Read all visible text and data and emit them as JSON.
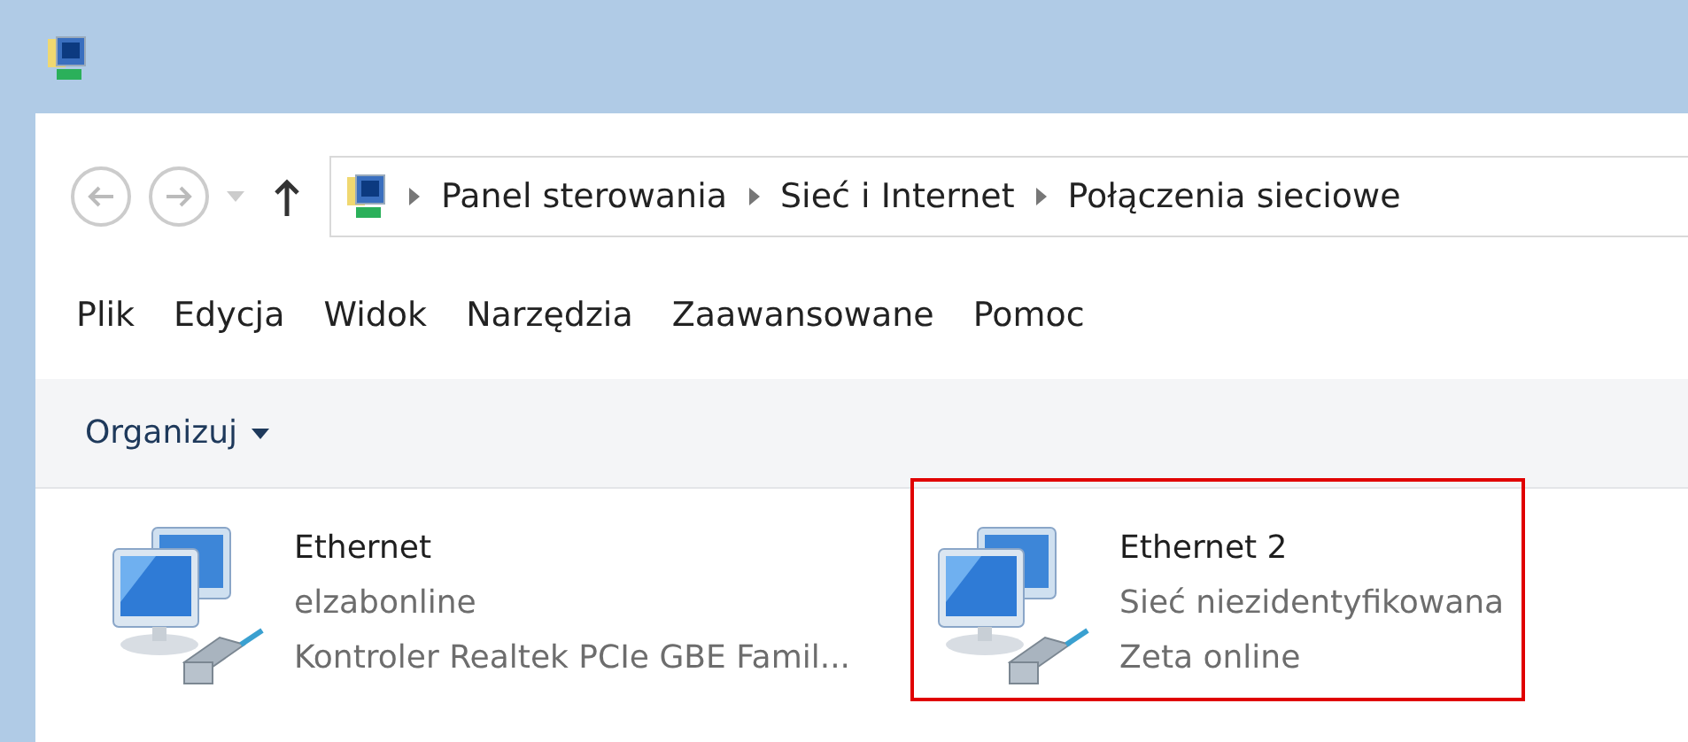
{
  "address_bar": {
    "breadcrumbs": [
      "Panel sterowania",
      "Sieć i Internet",
      "Połączenia sieciowe"
    ]
  },
  "menu": [
    "Plik",
    "Edycja",
    "Widok",
    "Narzędzia",
    "Zaawansowane",
    "Pomoc"
  ],
  "toolbar": {
    "organize": "Organizuj"
  },
  "connections": [
    {
      "name": "Ethernet",
      "network": "elzabonline",
      "adapter": "Kontroler Realtek PCIe GBE Famil...",
      "highlighted": false
    },
    {
      "name": "Ethernet 2",
      "network": "Sieć niezidentyfikowana",
      "adapter": "Zeta online",
      "highlighted": true
    }
  ]
}
